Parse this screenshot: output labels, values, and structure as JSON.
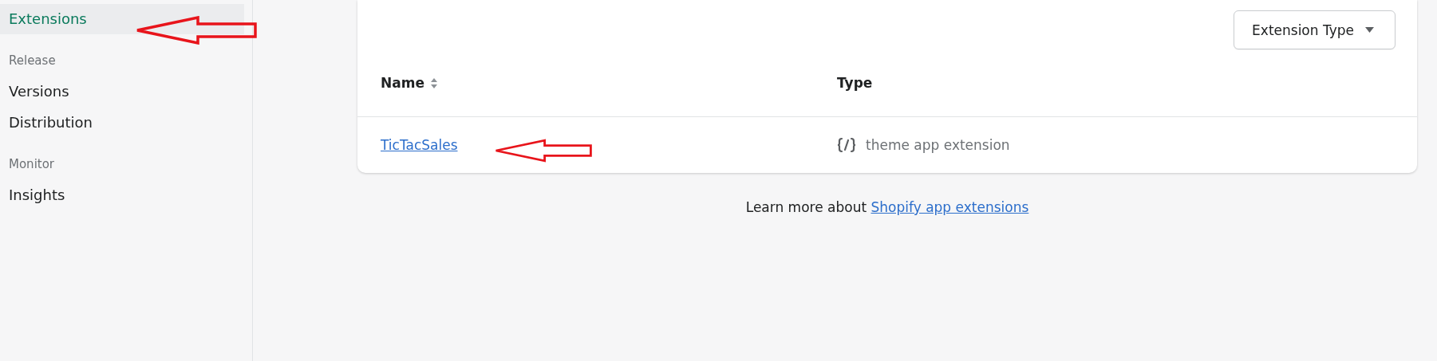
{
  "sidebar": {
    "items": [
      {
        "kind": "item",
        "label": "Extensions",
        "selected": true
      },
      {
        "kind": "heading",
        "label": "Release"
      },
      {
        "kind": "item",
        "label": "Versions",
        "selected": false
      },
      {
        "kind": "item",
        "label": "Distribution",
        "selected": false
      },
      {
        "kind": "heading",
        "label": "Monitor"
      },
      {
        "kind": "item",
        "label": "Insights",
        "selected": false
      }
    ]
  },
  "filter_button": {
    "label": "Extension Type"
  },
  "table": {
    "columns": [
      {
        "label": "Name",
        "sortable": true
      },
      {
        "label": "Type",
        "sortable": false
      }
    ],
    "rows": [
      {
        "name": "TicTacSales",
        "type": "theme app extension"
      }
    ]
  },
  "footer": {
    "text": "Learn more about",
    "link": "Shopify app extensions"
  },
  "annotations": [
    {
      "kind": "arrow"
    },
    {
      "kind": "arrow"
    }
  ]
}
